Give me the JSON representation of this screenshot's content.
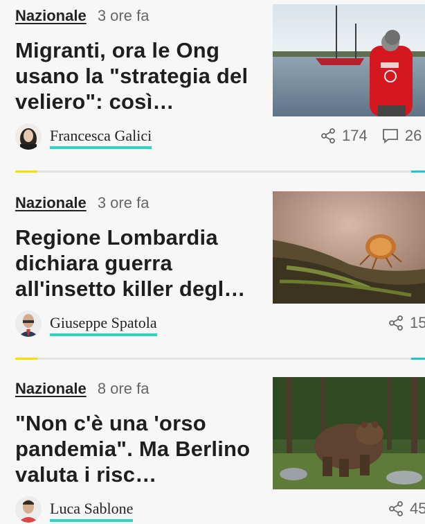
{
  "articles": [
    {
      "section": "Nazionale",
      "time": "3 ore fa",
      "title": "Migranti, ora le Ong usano la \"strategia del veliero\": così…",
      "author": "Francesca Galici",
      "shares": "174",
      "comments": "26",
      "image_icon": "sailboat-photo"
    },
    {
      "section": "Nazionale",
      "time": "3 ore fa",
      "title": "Regione Lombardia dichiara guerra all'insetto killer degl…",
      "author": "Giuseppe Spatola",
      "shares": "15",
      "image_icon": "insect-photo"
    },
    {
      "section": "Nazionale",
      "time": "8 ore fa",
      "title": "\"Non c'è una 'orso pandemia\". Ma Berlino valuta i risc…",
      "author": "Luca Sablone",
      "shares": "45",
      "image_icon": "bear-photo"
    }
  ],
  "colors": {
    "author_underline": "#2dd4bf",
    "divider_yellow": "#f5e100",
    "divider_cyan": "#22c5c7"
  },
  "icons": {
    "share": "share-icon",
    "comment": "comment-icon"
  }
}
